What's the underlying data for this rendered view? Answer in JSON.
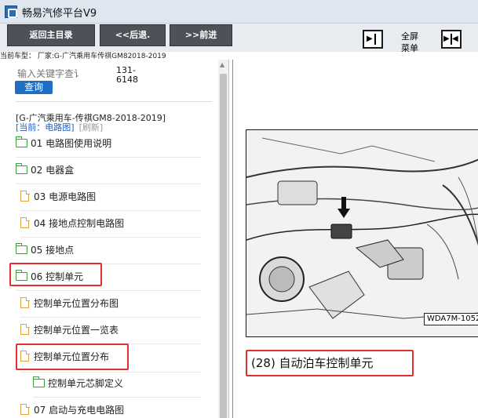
{
  "window": {
    "title": "畅易汽修平台V9"
  },
  "toolbar": {
    "back_main": "返回主目录",
    "prev": "<<后退.",
    "next": ">>前进",
    "fullscreen_label_line1": "全屏",
    "fullscreen_label_line2": "菜单"
  },
  "vehicle_info": "当前车型：  厂家:G-广汽乘用车传祺GM82018-2019",
  "search": {
    "placeholder": "输入关键字查讠",
    "button": "查询",
    "range_line1": "131-",
    "range_line2": "6148"
  },
  "car_title": "[G-广汽乘用车-传祺GM8-2018-2019]",
  "current": {
    "label": "[当前：电路图]",
    "refresh": "[刷新]"
  },
  "tree": [
    {
      "label": "01 电路图使用说明",
      "type": "folder"
    },
    {
      "label": "02 电器盒",
      "type": "folder"
    },
    {
      "label": "03 电源电路图",
      "type": "doc"
    },
    {
      "label": "04 接地点控制电路图",
      "type": "doc"
    },
    {
      "label": "05 接地点",
      "type": "folder"
    },
    {
      "label": "06 控制单元",
      "type": "folder",
      "highlighted": true
    },
    {
      "label": "控制单元位置分布图",
      "type": "doc"
    },
    {
      "label": "控制单元位置一览表",
      "type": "doc"
    },
    {
      "label": "控制单元位置分布",
      "type": "doc",
      "highlighted": true
    },
    {
      "label": "控制单元芯脚定义",
      "type": "folder"
    },
    {
      "label": "07 启动与充电电路图",
      "type": "doc"
    }
  ],
  "content": {
    "figure_code": "WDA7M-1052",
    "caption": "(28) 自动泊车控制单元"
  },
  "colors": {
    "accent_blue": "#1e6fc4",
    "highlight_red": "#e03030",
    "folder_green": "#3aa03a",
    "doc_orange": "#e0a63a"
  }
}
